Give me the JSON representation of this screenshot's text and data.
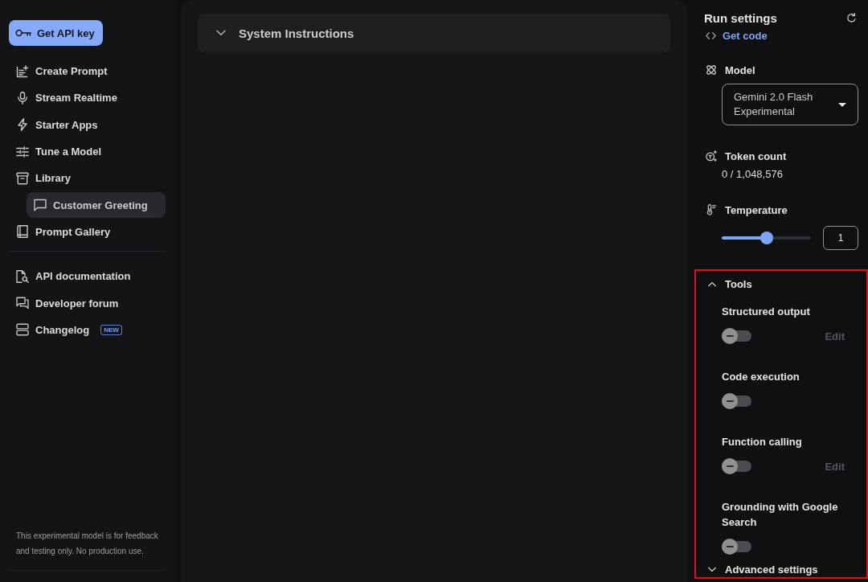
{
  "sidebar": {
    "api_key_button": "Get API key",
    "nav_items": [
      {
        "label": "Create Prompt",
        "selected": false
      },
      {
        "label": "Stream Realtime",
        "selected": false
      },
      {
        "label": "Starter Apps",
        "selected": false
      },
      {
        "label": "Tune a Model",
        "selected": false
      },
      {
        "label": "Library",
        "selected": false,
        "children": [
          {
            "label": "Customer Greeting",
            "selected": true
          }
        ]
      },
      {
        "label": "Prompt Gallery",
        "selected": false
      }
    ],
    "resource_links": [
      {
        "label": "API documentation"
      },
      {
        "label": "Developer forum"
      },
      {
        "label": "Changelog",
        "badge": "NEW"
      }
    ],
    "footer_note": "This experimental model is for feedback and testing only. No production use."
  },
  "main": {
    "system_instructions": {
      "title": "System Instructions",
      "expanded": false
    }
  },
  "run_settings": {
    "title": "Run settings",
    "get_code": "Get code",
    "model": {
      "label": "Model",
      "value": "Gemini 2.0 Flash Experimental"
    },
    "token_count": {
      "label": "Token count",
      "value": "0 / 1,048,576"
    },
    "temperature": {
      "label": "Temperature",
      "level": 0.5,
      "value": "1"
    },
    "tools": {
      "label": "Tools",
      "expanded": true,
      "highlighted": true,
      "items": [
        {
          "label": "Structured output",
          "on": false,
          "edit": {
            "label": "Edit",
            "disabled": true
          }
        },
        {
          "label": "Code execution",
          "on": false
        },
        {
          "label": "Function calling",
          "on": false,
          "edit": {
            "label": "Edit",
            "disabled": true
          }
        },
        {
          "label": "Grounding with Google Search",
          "on": false
        }
      ]
    },
    "advanced_settings": {
      "label": "Advanced settings",
      "expanded": false
    }
  }
}
